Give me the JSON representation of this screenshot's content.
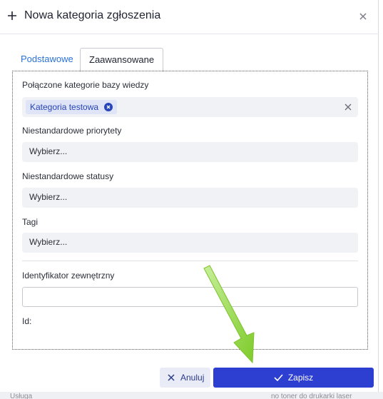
{
  "dialog": {
    "title": "Nowa kategoria zgłoszenia",
    "icons": {
      "header": "plus-icon",
      "close": "close-icon"
    }
  },
  "tabs": [
    {
      "label": "Podstawowe",
      "active": false
    },
    {
      "label": "Zaawansowane",
      "active": true
    }
  ],
  "form": {
    "linked_categories": {
      "label": "Połączone kategorie bazy wiedzy",
      "chips": [
        {
          "label": "Kategoria testowa"
        }
      ]
    },
    "custom_priorities": {
      "label": "Niestandardowe priorytety",
      "placeholder": "Wybierz..."
    },
    "custom_statuses": {
      "label": "Niestandardowe statusy",
      "placeholder": "Wybierz..."
    },
    "tags": {
      "label": "Tagi",
      "placeholder": "Wybierz..."
    },
    "external_id": {
      "label": "Identyfikator zewnętrzny",
      "value": ""
    },
    "id": {
      "label": "Id:"
    }
  },
  "footer": {
    "cancel_label": "Anuluj",
    "save_label": "Zapisz"
  },
  "colors": {
    "accent": "#2c3fd0",
    "link": "#2a73d6",
    "annotation_arrow": "#8fd43a"
  }
}
